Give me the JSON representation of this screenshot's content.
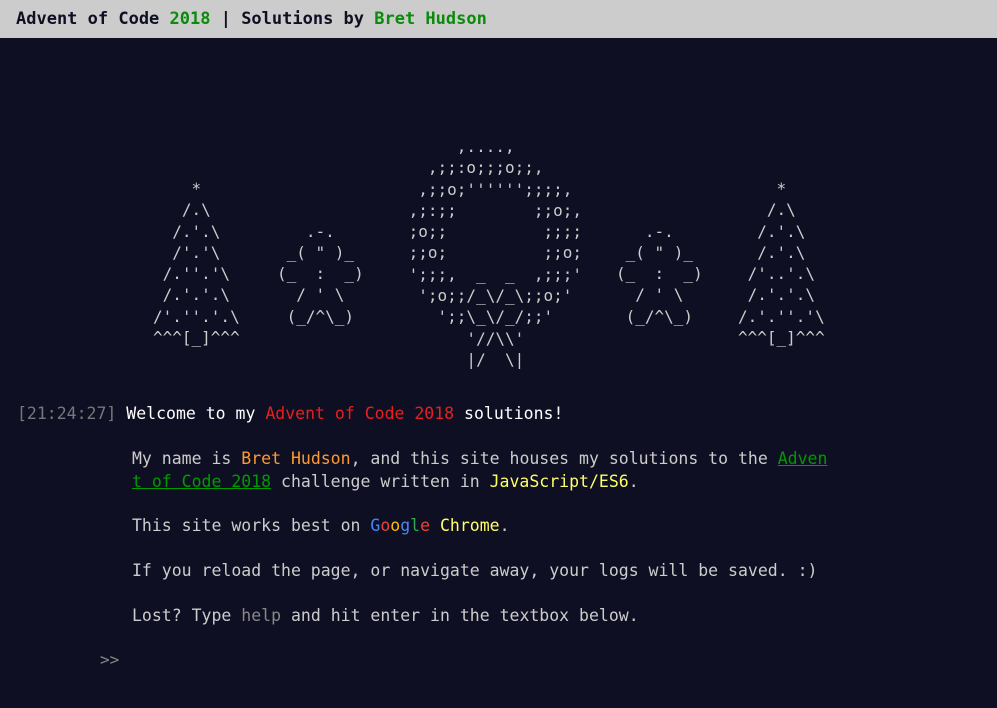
{
  "header": {
    "prefix": "Advent of Code ",
    "year": "2018",
    "separator": " | Solutions by ",
    "author": "Bret Hudson"
  },
  "ascii_art": {
    "tree_left": "    *\n   /.\\\n  /.'.\\\n  /'.'\\\n /.''.'\\\n /.'.'.\\\n/'.''.'.\\\n^^^[_]^^^",
    "snowman_left": "\n\n   .-.\n _( \" )_\n(_  :  _)\n  / ' \\\n (_/^\\_)",
    "wreath": "      ,....,\n   ,;;:o;;;o;;,\n  ,;;o;'''''';;;;,\n ,;:;;        ;;o;,\n ;o;;          ;;;;\n ;;o;          ;;o;\n ';;;,  _  _  ,;;;'\n  ';o;;/_\\/_\\;;o;'\n    ';;\\_\\/_/;;'\n       '//\\\\'\n       |/  \\|",
    "snowman_right": "\n\n   .-.\n _( \" )_\n(_  :  _)\n  / ' \\\n (_/^\\_)",
    "tree_right": "    *\n   /.\\\n  /.'.\\\n  /.'.\\\n /'..'.\\\n /.'.'.\\\n/.'.''.'\\\n^^^[_]^^^"
  },
  "console": {
    "timestamp": "[21:24:27]",
    "welcome": {
      "before": "Welcome to my ",
      "highlight": "Advent of Code 2018",
      "after": " solutions!"
    },
    "intro": {
      "before": "My name is ",
      "name": "Bret Hudson",
      "middle": ", and this site houses my solutions to the ",
      "link_part1": "Adven",
      "link_part2": "t of Code 2018",
      "after_link": " challenge written in ",
      "lang": "JavaScript/ES6",
      "end": "."
    },
    "browser": {
      "before": "This site works best on ",
      "google": [
        "G",
        "o",
        "o",
        "g",
        "l",
        "e"
      ],
      "space": " ",
      "chrome": "Chrome",
      "end": "."
    },
    "reload_note": "If you reload the page, or navigate away, your logs will be saved. :)",
    "lost": {
      "before": "Lost? Type ",
      "command": "help",
      "after": " and hit enter in the textbox below."
    }
  },
  "input": {
    "prompt": ">>",
    "value": ""
  },
  "colors": {
    "background": "#0f0f23",
    "header_bg": "#cccccc",
    "accent_green": "#009900",
    "highlight_red": "#e81f1f",
    "name_orange": "#ff9a2f",
    "lang_yellow": "#ffff66"
  }
}
